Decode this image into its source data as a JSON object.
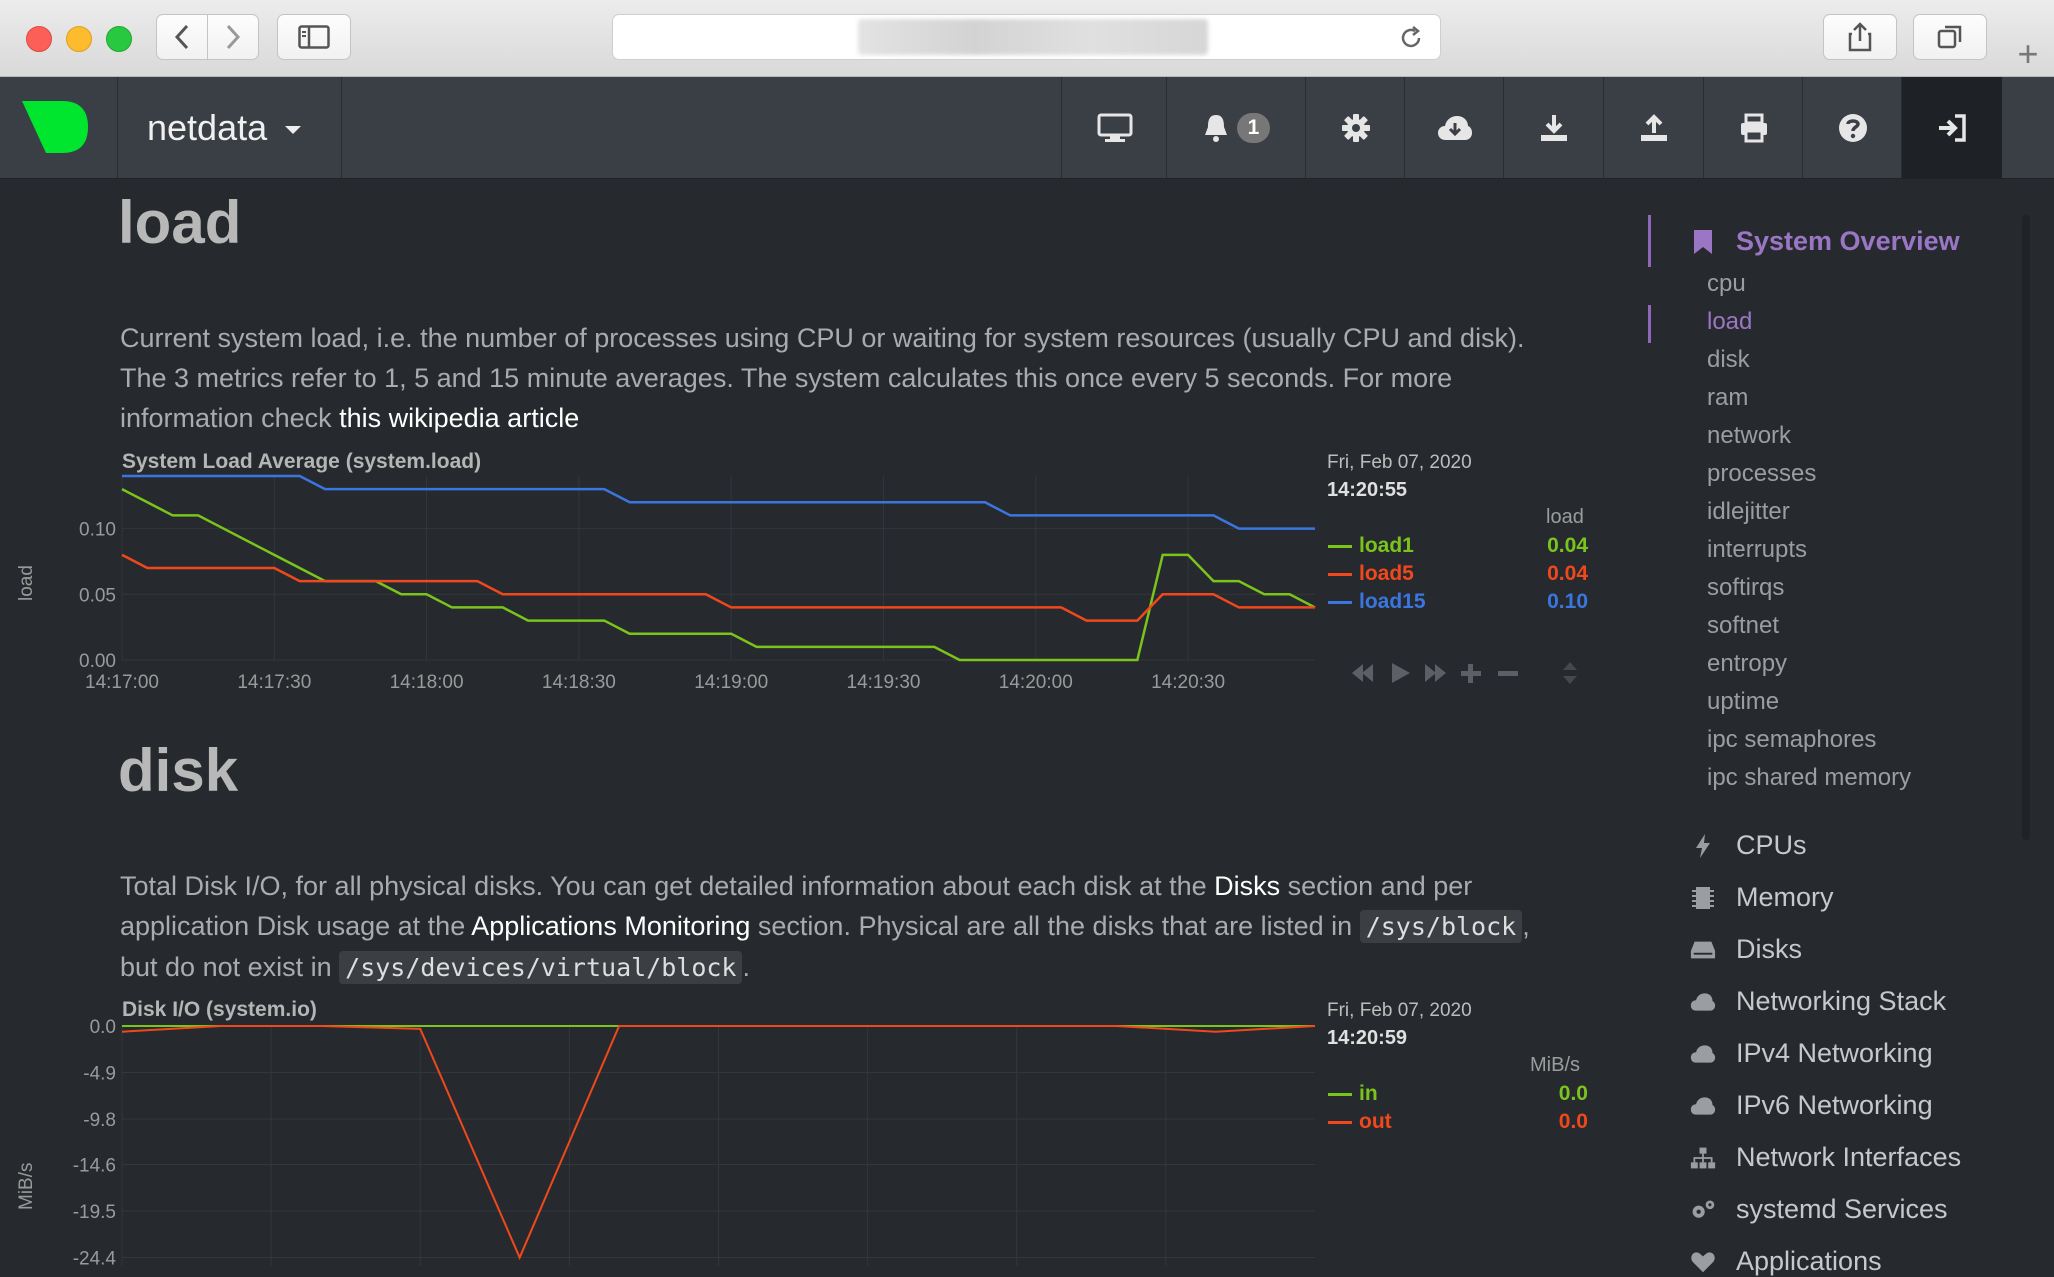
{
  "app": {
    "name": "netdata"
  },
  "nav": {
    "notification_count": "1"
  },
  "colors": {
    "load1": "#7ac41b",
    "load5": "#f0481d",
    "load15": "#3a76e0",
    "accent": "#8e67b8",
    "logo": "#00e52e"
  },
  "load_section": {
    "heading": "load",
    "para_line1": "Current system load, i.e. the number of processes using CPU or waiting for system resources (usually CPU and disk).",
    "para_line2": "The 3 metrics refer to 1, 5 and 15 minute averages. The system calculates this once every 5 seconds. For more",
    "para_line3": "information check ",
    "link_text": "this wikipedia article",
    "chart_title": "System Load Average (system.load)",
    "ylabel": "load",
    "date": "Fri, Feb 07, 2020",
    "time": "14:20:55",
    "unit": "load",
    "legend": [
      {
        "name": "load1",
        "value": "0.04"
      },
      {
        "name": "load5",
        "value": "0.04"
      },
      {
        "name": "load15",
        "value": "0.10"
      }
    ]
  },
  "disk_section": {
    "heading": "disk",
    "para_a": "Total Disk I/O, for all physical disks. You can get detailed information about each disk at the ",
    "link_disks": "Disks",
    "para_b": " section and per",
    "para_c": "application Disk usage at the ",
    "link_apps": "Applications Monitoring",
    "para_d": " section. Physical are all the disks that are listed in ",
    "code1": "/sys/block",
    "para_e": ",",
    "para_f": "but do not exist in ",
    "code2": "/sys/devices/virtual/block",
    "para_g": ".",
    "chart_title": "Disk I/O (system.io)",
    "ylabel": "MiB/s",
    "date": "Fri, Feb 07, 2020",
    "time": "14:20:59",
    "unit": "MiB/s",
    "legend": [
      {
        "name": "in",
        "value": "0.0"
      },
      {
        "name": "out",
        "value": "0.0"
      }
    ]
  },
  "sidebar": {
    "overview_title": "System Overview",
    "sub_items": [
      "cpu",
      "load",
      "disk",
      "ram",
      "network",
      "processes",
      "idlejitter",
      "interrupts",
      "softirqs",
      "softnet",
      "entropy",
      "uptime",
      "ipc semaphores",
      "ipc shared memory"
    ],
    "sections": [
      {
        "label": "CPUs",
        "icon": "bolt-icon"
      },
      {
        "label": "Memory",
        "icon": "memory-chip-icon"
      },
      {
        "label": "Disks",
        "icon": "hdd-icon"
      },
      {
        "label": "Networking Stack",
        "icon": "cloud-icon"
      },
      {
        "label": "IPv4 Networking",
        "icon": "cloud-icon"
      },
      {
        "label": "IPv6 Networking",
        "icon": "cloud-icon"
      },
      {
        "label": "Network Interfaces",
        "icon": "sitemap-icon"
      },
      {
        "label": "systemd Services",
        "icon": "gears-icon"
      },
      {
        "label": "Applications",
        "icon": "heartbeat-icon"
      }
    ]
  },
  "chart_data": [
    {
      "type": "line",
      "title": "System Load Average (system.load)",
      "ylabel": "load",
      "xlabel": "",
      "x_ticks": [
        "14:17:00",
        "14:17:30",
        "14:18:00",
        "14:18:30",
        "14:19:00",
        "14:19:30",
        "14:20:00",
        "14:20:30"
      ],
      "y_ticks": [
        "0.00",
        "0.05",
        "0.10"
      ],
      "ylim": [
        0,
        0.14
      ],
      "x_range_seconds": [
        0,
        235
      ],
      "x": [
        0,
        5,
        10,
        15,
        20,
        25,
        30,
        35,
        40,
        45,
        50,
        55,
        60,
        65,
        70,
        75,
        80,
        85,
        90,
        95,
        100,
        105,
        110,
        115,
        120,
        125,
        130,
        135,
        140,
        145,
        150,
        155,
        160,
        165,
        170,
        175,
        180,
        185,
        190,
        195,
        200,
        205,
        210,
        215,
        220,
        225,
        230,
        235
      ],
      "series": [
        {
          "name": "load1",
          "values": [
            0.13,
            0.12,
            0.11,
            0.11,
            0.1,
            0.09,
            0.08,
            0.07,
            0.06,
            0.06,
            0.06,
            0.05,
            0.05,
            0.04,
            0.04,
            0.04,
            0.03,
            0.03,
            0.03,
            0.03,
            0.02,
            0.02,
            0.02,
            0.02,
            0.02,
            0.01,
            0.01,
            0.01,
            0.01,
            0.01,
            0.01,
            0.01,
            0.01,
            0.0,
            0.0,
            0.0,
            0.0,
            0.0,
            0.0,
            0.0,
            0.0,
            0.08,
            0.08,
            0.06,
            0.06,
            0.05,
            0.05,
            0.04
          ]
        },
        {
          "name": "load5",
          "values": [
            0.08,
            0.07,
            0.07,
            0.07,
            0.07,
            0.07,
            0.07,
            0.06,
            0.06,
            0.06,
            0.06,
            0.06,
            0.06,
            0.06,
            0.06,
            0.05,
            0.05,
            0.05,
            0.05,
            0.05,
            0.05,
            0.05,
            0.05,
            0.05,
            0.04,
            0.04,
            0.04,
            0.04,
            0.04,
            0.04,
            0.04,
            0.04,
            0.04,
            0.04,
            0.04,
            0.04,
            0.04,
            0.04,
            0.03,
            0.03,
            0.03,
            0.05,
            0.05,
            0.05,
            0.04,
            0.04,
            0.04,
            0.04
          ]
        },
        {
          "name": "load15",
          "values": [
            0.14,
            0.14,
            0.14,
            0.14,
            0.14,
            0.14,
            0.14,
            0.14,
            0.13,
            0.13,
            0.13,
            0.13,
            0.13,
            0.13,
            0.13,
            0.13,
            0.13,
            0.13,
            0.13,
            0.13,
            0.12,
            0.12,
            0.12,
            0.12,
            0.12,
            0.12,
            0.12,
            0.12,
            0.12,
            0.12,
            0.12,
            0.12,
            0.12,
            0.12,
            0.12,
            0.11,
            0.11,
            0.11,
            0.11,
            0.11,
            0.11,
            0.11,
            0.11,
            0.11,
            0.1,
            0.1,
            0.1,
            0.1
          ]
        }
      ],
      "grid": true,
      "legend": "right"
    },
    {
      "type": "line",
      "title": "Disk I/O (system.io)",
      "ylabel": "MiB/s",
      "xlabel": "",
      "y_ticks": [
        "0.0",
        "-4.9",
        "-9.8",
        "-14.6",
        "-19.5",
        "-24.4"
      ],
      "ylim": [
        -24.4,
        0
      ],
      "x": [
        0,
        5,
        10,
        15,
        20,
        25,
        30,
        35,
        40,
        45,
        50,
        55,
        60
      ],
      "series": [
        {
          "name": "in",
          "values": [
            0,
            0,
            0,
            0,
            0,
            0,
            0,
            0,
            0,
            0,
            0,
            0,
            0
          ]
        },
        {
          "name": "out",
          "values": [
            -0.6,
            0,
            0,
            -0.3,
            -24.4,
            0,
            0,
            0,
            0,
            0,
            0,
            -0.6,
            0
          ]
        }
      ],
      "grid": true,
      "legend": "right"
    }
  ]
}
